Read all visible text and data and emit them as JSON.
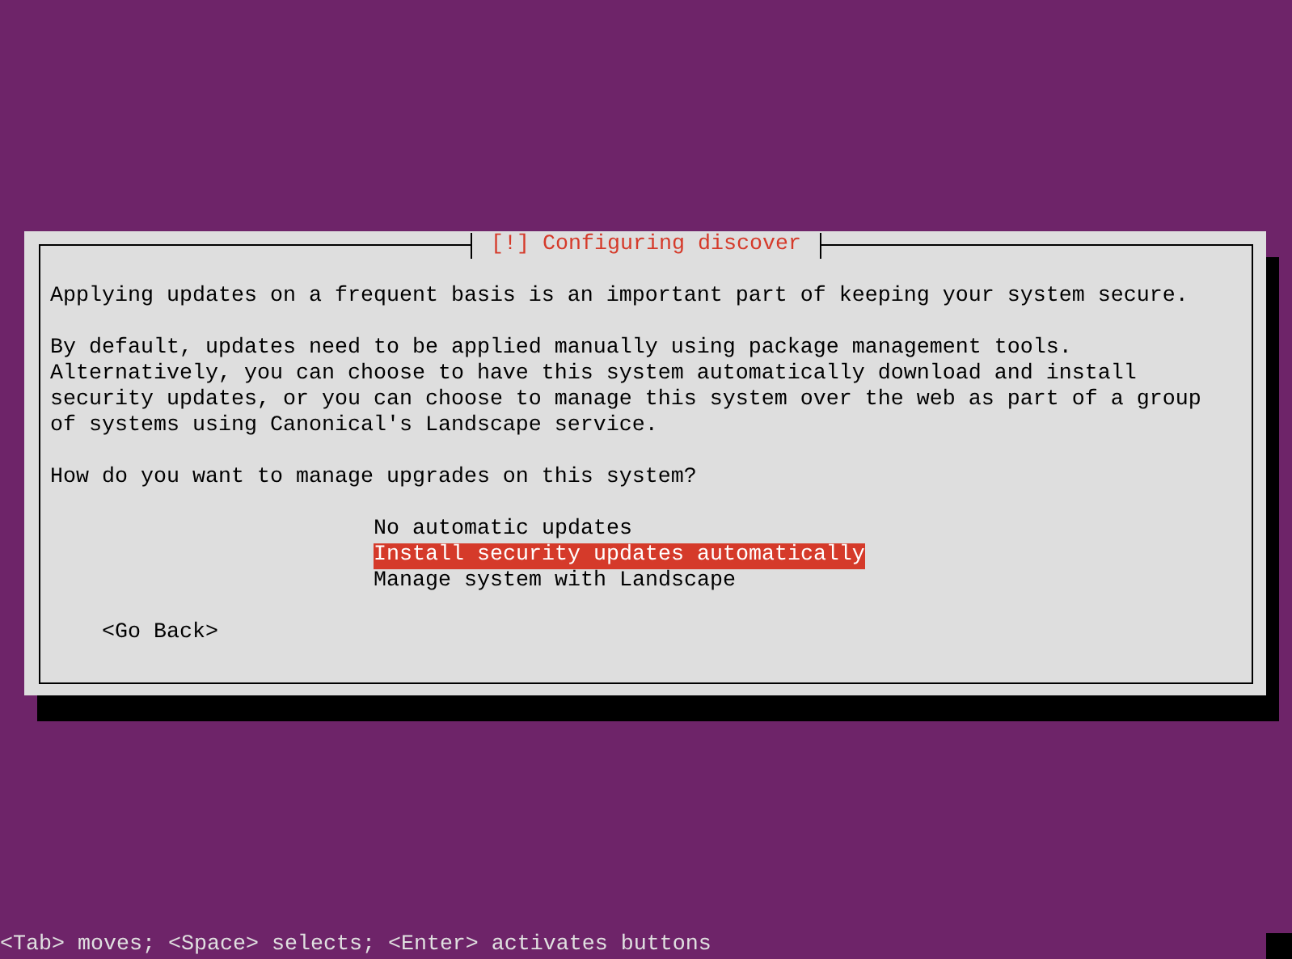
{
  "dialog": {
    "title": "[!] Configuring discover",
    "paragraphs": [
      "Applying updates on a frequent basis is an important part of keeping your system secure.",
      "By default, updates need to be applied manually using package management tools.\nAlternatively, you can choose to have this system automatically download and install\nsecurity updates, or you can choose to manage this system over the web as part of a group\nof systems using Canonical's Landscape service.",
      "How do you want to manage upgrades on this system?"
    ],
    "options": [
      {
        "label": "No automatic updates",
        "selected": false
      },
      {
        "label": "Install security updates automatically",
        "selected": true
      },
      {
        "label": "Manage system with Landscape",
        "selected": false
      }
    ],
    "back_button": "<Go Back>"
  },
  "status_bar": "<Tab> moves; <Space> selects; <Enter> activates buttons"
}
